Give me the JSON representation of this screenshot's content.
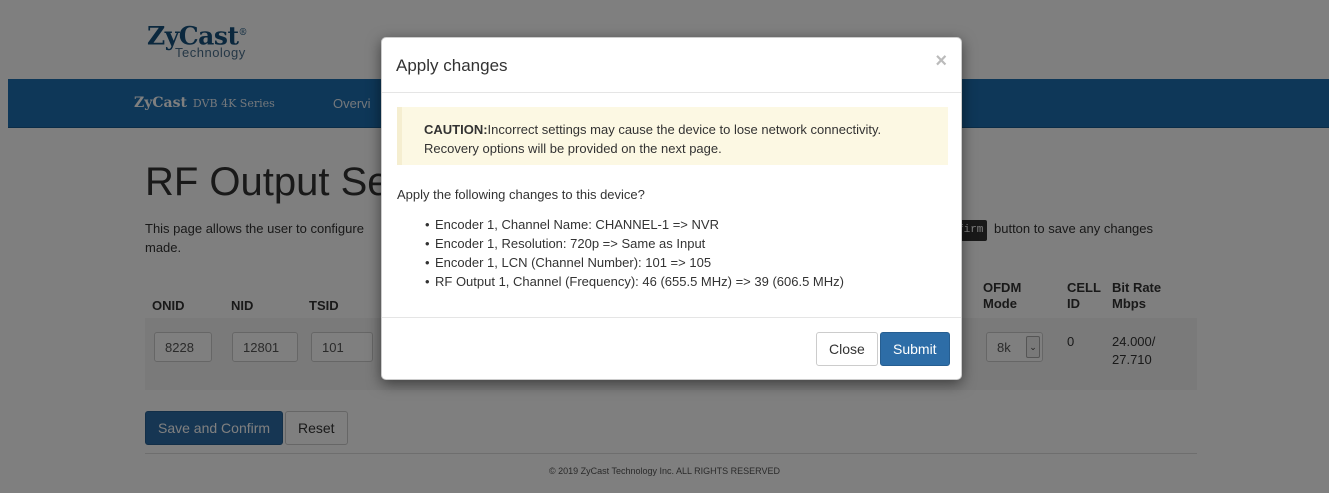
{
  "header": {
    "logo_main": "ZyCast",
    "logo_sub": "Technology"
  },
  "navbar": {
    "brand": "ZyCast",
    "series": "DVB 4K Series",
    "link_overview": "Overvi"
  },
  "main": {
    "title": "RF Output Setu",
    "intro_line1": "This page allows the user to configure",
    "intro_code": "firm",
    "intro_after_code": "button to save any changes",
    "intro_line2": "made.",
    "columns": {
      "onid": "ONID",
      "nid": "NID",
      "tsid": "TSID",
      "ofdm_mode_1": "OFDM",
      "ofdm_mode_2": "Mode",
      "cell_id_1": "CELL",
      "cell_id_2": "ID",
      "bitrate_1": "Bit Rate",
      "bitrate_2": "Mbps"
    },
    "row": {
      "onid": "8228",
      "nid": "12801",
      "tsid": "101",
      "ofdm_mode": "8k",
      "cell_id": "0",
      "bitrate_1": "24.000/",
      "bitrate_2": "27.710"
    },
    "save_label": "Save and Confirm",
    "reset_label": "Reset"
  },
  "footer": {
    "text": "© 2019 ZyCast Technology Inc. ALL RIGHTS RESERVED"
  },
  "modal": {
    "title": "Apply changes",
    "close_glyph": "×",
    "caution_label": "CAUTION:",
    "caution_text": "Incorrect settings may cause the device to lose network connectivity.",
    "caution_text2": "Recovery options will be provided on the next page.",
    "question": "Apply the following changes to this device?",
    "changes": [
      "Encoder 1, Channel Name: CHANNEL-1 => NVR",
      "Encoder 1, Resolution: 720p => Same as Input",
      "Encoder 1, LCN (Channel Number): 101 => 105",
      "RF Output 1, Channel (Frequency): 46 (655.5 MHz) => 39 (606.5 MHz)"
    ],
    "close_label": "Close",
    "submit_label": "Submit"
  },
  "colors": {
    "navbar": "#1d6fb1",
    "primary_button": "#2d6da7",
    "alert_bg": "#fcf8e3"
  }
}
